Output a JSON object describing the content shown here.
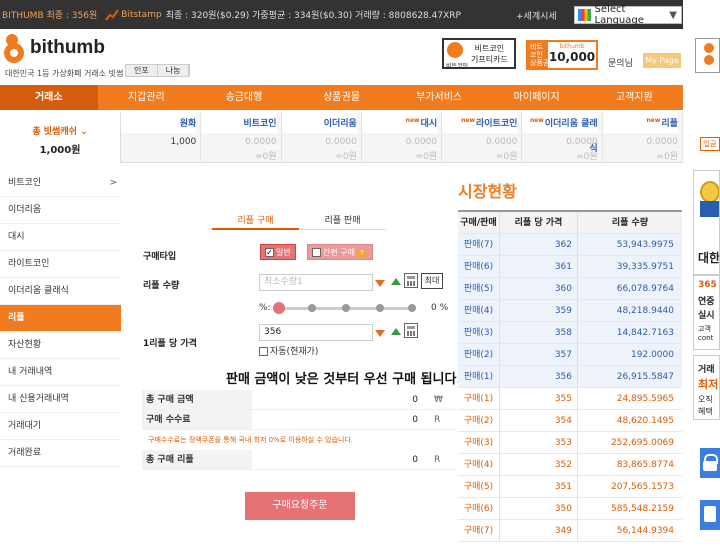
{
  "topbar": {
    "bithumb_price": "BITHUMB 최종 : 356원",
    "bitstamp_label": "Bitstamp",
    "bitstamp_info": "최종 : 320원($0.29)  가중평균 : 334원($0.30)  거래량 : 8808628.47XRP",
    "world_time": "+세계시세",
    "language": "Select Language"
  },
  "header": {
    "logo": "bithumb",
    "slogan": "대한민국 1등 가상화폐 거래소 빗썸",
    "info_btn": "인포",
    "share_btn": "나눔",
    "gift_banner_l1": "비트코인",
    "gift_banner_l2": "기프티카드",
    "gift_banner_small": "비트코인",
    "giftcard_side": "비트\n코인\n상품권",
    "giftcard_brand": "bithumb",
    "giftcard_value": "10,000",
    "ask": "문의",
    "ask_suffix": "님",
    "mypage": "My Page"
  },
  "nav": [
    "거래소",
    "지갑관리",
    "송금대행",
    "상품권몰",
    "부가서비스",
    "마이페이지",
    "고객지원"
  ],
  "balance": {
    "cash_label": "총 빗썸캐쉬",
    "cash_value": "1,000원",
    "columns": [
      {
        "new": "",
        "name": "원화",
        "amount": "1,000",
        "krw": ""
      },
      {
        "new": "",
        "name": "비트코인",
        "amount": "0.0000",
        "krw": "≈0원"
      },
      {
        "new": "",
        "name": "이더리움",
        "amount": "0.0000",
        "krw": "≈0원"
      },
      {
        "new": "new",
        "name": "대시",
        "amount": "0.0000",
        "krw": "≈0원"
      },
      {
        "new": "new",
        "name": "라이트코인",
        "amount": "0.0000",
        "krw": "≈0원"
      },
      {
        "new": "new",
        "name": "이더리움 클래식",
        "amount": "0.0000",
        "krw": "≈0원"
      },
      {
        "new": "new",
        "name": "리플",
        "amount": "0.0000",
        "krw": "≈0원"
      }
    ]
  },
  "sidebar": [
    "비트코인",
    "이더리움",
    "대시",
    "라이트코인",
    "이더리움 클래식",
    "리플",
    "자산현황",
    "내 거래내역",
    "내 신용거래내역",
    "거래대기",
    "거래완료"
  ],
  "form": {
    "tab_buy": "리플 구매",
    "tab_sell": "리플 판매",
    "type_label": "구매타입",
    "type_normal": "일반",
    "type_simple": "간편 구매",
    "qty_label": "리플 수량",
    "qty_placeholder": "최소수량1",
    "max_btn": "최대",
    "pct_left": "%:",
    "pct_right": "0 %",
    "price_label": "1리플 당 가격",
    "price_value": "356",
    "auto_label": "자동(현재가)",
    "notice": "판매 금액이 낮은 것부터 우선 구매 됩니다.",
    "total_label": "총 구매 금액",
    "total_value": "0",
    "total_unit": "₩",
    "fee_label": "구매 수수료",
    "fee_value": "0",
    "fee_unit": "R",
    "fee_note": "구매수수료는 정액쿠폰을 통해 국내 최저 0%로 이용하실 수 있습니다.",
    "qty_total_label": "총 구매 리플",
    "qty_total_value": "0",
    "qty_total_unit": "R",
    "submit": "구매요청주문"
  },
  "market": {
    "title": "시장현황",
    "headers": [
      "구매/판매",
      "리플 당 가격",
      "리플 수량"
    ],
    "rows": [
      {
        "side": "sell",
        "label": "판매(7)",
        "price": "362",
        "qty": "53,943.9975"
      },
      {
        "side": "sell",
        "label": "판매(6)",
        "price": "361",
        "qty": "39,335.9751"
      },
      {
        "side": "sell",
        "label": "판매(5)",
        "price": "360",
        "qty": "66,078.9764"
      },
      {
        "side": "sell",
        "label": "판매(4)",
        "price": "359",
        "qty": "48,218.9440"
      },
      {
        "side": "sell",
        "label": "판매(3)",
        "price": "358",
        "qty": "14,842.7163"
      },
      {
        "side": "sell",
        "label": "판매(2)",
        "price": "357",
        "qty": "192.0000"
      },
      {
        "side": "sell",
        "label": "판매(1)",
        "price": "356",
        "qty": "26,915.5847"
      },
      {
        "side": "buy",
        "label": "구매(1)",
        "price": "355",
        "qty": "24,895.5965"
      },
      {
        "side": "buy",
        "label": "구매(2)",
        "price": "354",
        "qty": "48,620.1495"
      },
      {
        "side": "buy",
        "label": "구매(3)",
        "price": "353",
        "qty": "252,695.0069"
      },
      {
        "side": "buy",
        "label": "구매(4)",
        "price": "352",
        "qty": "83,865.8774"
      },
      {
        "side": "buy",
        "label": "구매(5)",
        "price": "351",
        "qty": "207,565.1573"
      },
      {
        "side": "buy",
        "label": "구매(6)",
        "price": "350",
        "qty": "585,548.2159"
      },
      {
        "side": "buy",
        "label": "구매(7)",
        "price": "349",
        "qty": "56,144.9394"
      }
    ]
  },
  "right": {
    "tag": "입금",
    "ad1_text": "대한",
    "ad2_l1": "365",
    "ad2_l2": "연중",
    "ad2_l3": "실시",
    "ad2_l4": "고객",
    "ad2_l5": "cont",
    "ad3_l1": "거래",
    "ad3_l2": "최저",
    "ad3_l3": "오직",
    "ad3_l4": "혜택"
  },
  "colors": {
    "brand": "#f07c1f",
    "buy": "#e25a00",
    "sell": "#2a5db0",
    "submit": "#e57373"
  }
}
